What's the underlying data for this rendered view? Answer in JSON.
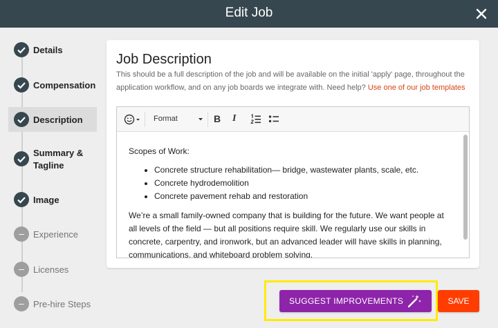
{
  "header": {
    "title": "Edit Job",
    "close_icon": "close-icon"
  },
  "sidebar": {
    "steps": [
      {
        "label": "Details",
        "status": "done"
      },
      {
        "label": "Compensation",
        "status": "done"
      },
      {
        "label": "Description",
        "status": "done",
        "active": true
      },
      {
        "label": "Summary & Tagline",
        "status": "done"
      },
      {
        "label": "Image",
        "status": "done"
      },
      {
        "label": "Experience",
        "status": "todo"
      },
      {
        "label": "Licenses",
        "status": "todo"
      },
      {
        "label": "Pre-hire Steps",
        "status": "todo"
      }
    ],
    "todo_marker": "–"
  },
  "card": {
    "title": "Job Description",
    "help_text": "This should be a full description of the job and will be available on the initial 'apply' page, throughout the application workflow, and on any job boards we integrate with. Need help?",
    "help_link": "Use one of our job templates"
  },
  "editor": {
    "toolbar": {
      "emoji_icon": "emoji-icon",
      "format_label": "Format",
      "bold_label": "B",
      "italic_label": "I",
      "ordered_list_icon": "ordered-list-icon",
      "bullet_list_icon": "bullet-list-icon"
    },
    "content": {
      "intro": "Scopes of Work:",
      "bullets": [
        "Concrete structure rehabilitation— bridge, wastewater plants, scale, etc.",
        "Concrete hydrodemolition",
        "Concrete pavement rehab and restoration"
      ],
      "paragraph": "We’re a small family-owned company that is building for the future. We want people at all levels of the field — but all positions require skill. We regularly use our skills in concrete, carpentry, and ironwork, but an advanced leader will have skills in planning, communications, and whiteboard problem solving."
    }
  },
  "actions": {
    "suggest_label": "SUGGEST IMPROVEMENTS",
    "suggest_icon": "magic-wand-icon",
    "save_label": "SAVE"
  },
  "colors": {
    "header_bg": "#37474f",
    "suggest_bg": "#8e24aa",
    "save_bg": "#ff3d00",
    "highlight": "#ffeb00",
    "link": "#d84315"
  }
}
